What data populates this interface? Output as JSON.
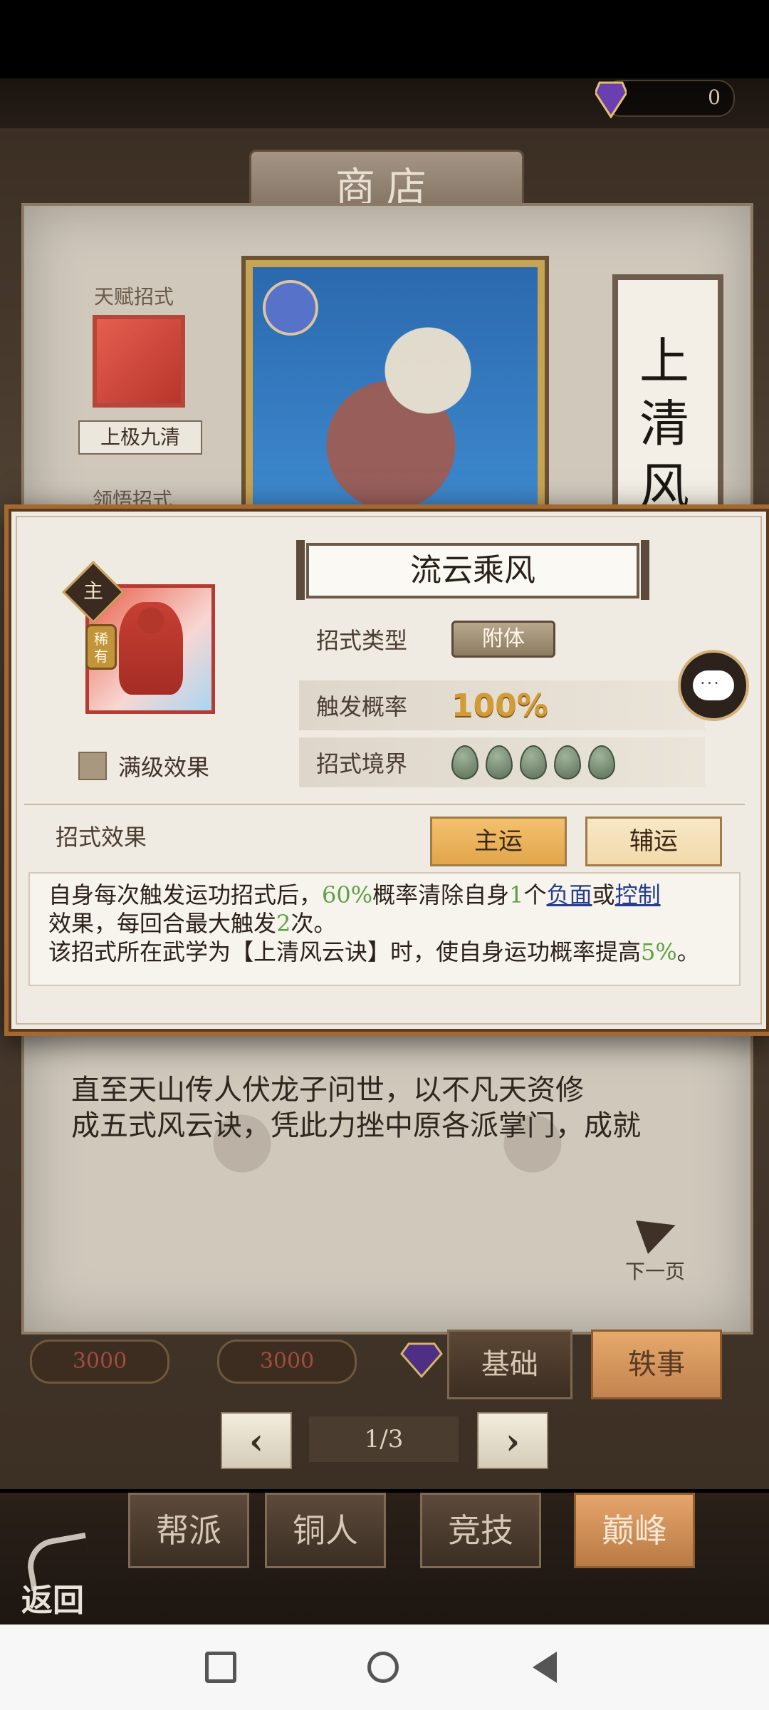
{
  "top": {
    "currency": "0"
  },
  "shop": {
    "title": "商店",
    "left": {
      "talent_label": "天赋招式",
      "skill_name": "上极九清",
      "sub_label": "领悟招式"
    },
    "banner_title": "上清风云",
    "story_lines": [
      "直至天山传人伏龙子问世，以不凡天资修",
      "成五式风云诀，凭此力挫中原各派掌门，成就"
    ],
    "next_page": "下一页"
  },
  "prices": [
    "3000",
    "3000"
  ],
  "tabs": {
    "basic": "基础",
    "misc": "轶事"
  },
  "pager": {
    "text": "1/3",
    "prev": "‹",
    "next": "›"
  },
  "bottom_tabs": [
    "帮派",
    "铜人",
    "竞技",
    "巅峰"
  ],
  "back": "返回",
  "modal": {
    "skill_name": "流云乘风",
    "badge_main": "主",
    "badge_rare": "稀有",
    "max_level": "满级效果",
    "type_label": "招式类型",
    "type_value": "附体",
    "rate_label": "触发概率",
    "rate_value": "100%",
    "realm_label": "招式境界",
    "effect_label": "招式效果",
    "btn_primary": "主运",
    "btn_secondary": "辅运",
    "desc": {
      "p1a": "自身每次触发运功招式后，",
      "p1b": "60%",
      "p1c": "概率清除自身",
      "p1d": "1",
      "p1e": "个",
      "p1f": "负面",
      "p1g": "或",
      "p1h": "控制",
      "p2a": "效果，每回合最大触发",
      "p2b": "2",
      "p2c": "次。",
      "p3a": "该招式所在武学为【上清风云诀】时，使自身运功概率提高",
      "p3b": "5%",
      "p3c": "。"
    }
  }
}
